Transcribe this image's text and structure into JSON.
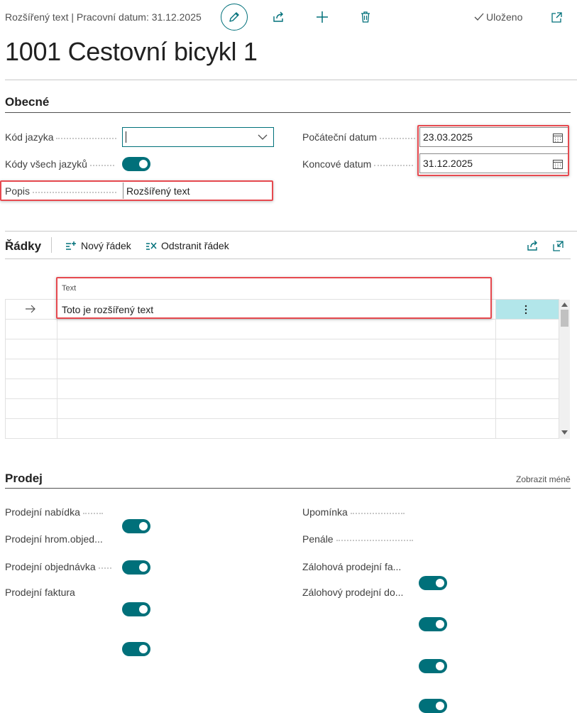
{
  "header": {
    "breadcrumb": "Rozšířený text | Pracovní datum: 31.12.2025",
    "saved_label": "Uloženo",
    "title": "1001 Cestovní bicykl 1"
  },
  "general": {
    "section_title": "Obecné",
    "language_code_label": "Kód jazyka",
    "language_code_value": "",
    "all_language_codes_label": "Kódy všech jazyků",
    "all_language_codes_on": true,
    "description_label": "Popis",
    "description_value": "Rozšířený text",
    "start_date_label": "Počáteční datum",
    "start_date_value": "23.03.2025",
    "end_date_label": "Koncové datum",
    "end_date_value": "31.12.2025"
  },
  "lines": {
    "section_title": "Řádky",
    "new_line_label": "Nový řádek",
    "delete_line_label": "Odstranit řádek",
    "column_text_header": "Text",
    "rows": [
      {
        "text": "Toto je rozšířený text",
        "current": true
      },
      {
        "text": ""
      },
      {
        "text": ""
      },
      {
        "text": ""
      },
      {
        "text": ""
      },
      {
        "text": ""
      }
    ]
  },
  "sales": {
    "section_title": "Prodej",
    "show_less_label": "Zobrazit méně",
    "left_fields": [
      {
        "label": "Prodejní nabídka",
        "on": true
      },
      {
        "label": "Prodejní hrom.objed...",
        "on": true
      },
      {
        "label": "Prodejní objednávka",
        "on": true
      },
      {
        "label": "Prodejní faktura",
        "on": true
      }
    ],
    "right_fields": [
      {
        "label": "Upomínka",
        "on": true
      },
      {
        "label": "Penále",
        "on": true
      },
      {
        "label": "Zálohová prodejní fa...",
        "on": true
      },
      {
        "label": "Zálohový prodejní do...",
        "on": true
      }
    ]
  },
  "colors": {
    "accent": "#00707a",
    "highlight_box": "#e6494f",
    "selected_cell": "#b2e6ea"
  }
}
